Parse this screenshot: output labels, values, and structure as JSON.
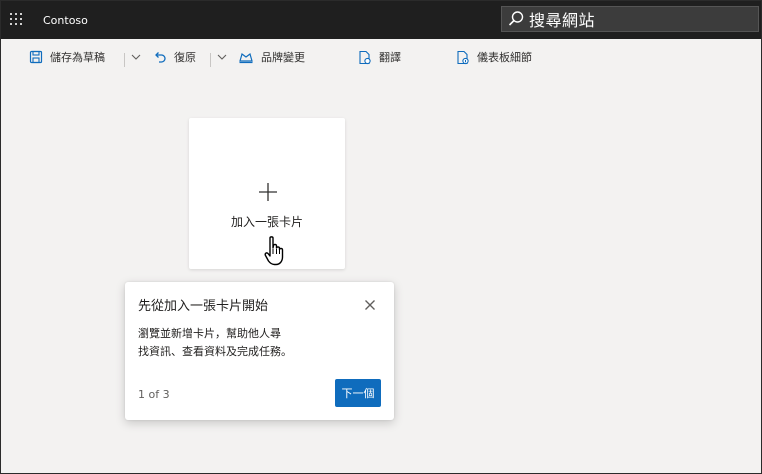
{
  "header": {
    "app_title": "Contoso",
    "search_placeholder": "搜尋網站"
  },
  "toolbar": {
    "save_draft": "儲存為草稿",
    "undo": "復原",
    "brand_change": "品牌變更",
    "translate": "翻譯",
    "dashboard_details": "儀表板細節"
  },
  "canvas": {
    "add_card_label": "加入一張卡片"
  },
  "callout": {
    "title": "先從加入一張卡片開始",
    "body_line1": "瀏覽並新增卡片，幫助他人尋",
    "body_line2": "找資訊、查看資料及完成任務。",
    "step": "1 of 3",
    "next_label": "下一個"
  },
  "colors": {
    "suitebar": "#1f1f1f",
    "background": "#f3f2f1",
    "accent": "#0f6cbd",
    "icon_blue": "#0f6cbd"
  },
  "icons": [
    "waffle-icon",
    "search-icon",
    "save-icon",
    "undo-icon",
    "brand-icon",
    "translate-icon",
    "details-icon",
    "plus-icon",
    "hand-cursor-icon",
    "close-icon"
  ]
}
